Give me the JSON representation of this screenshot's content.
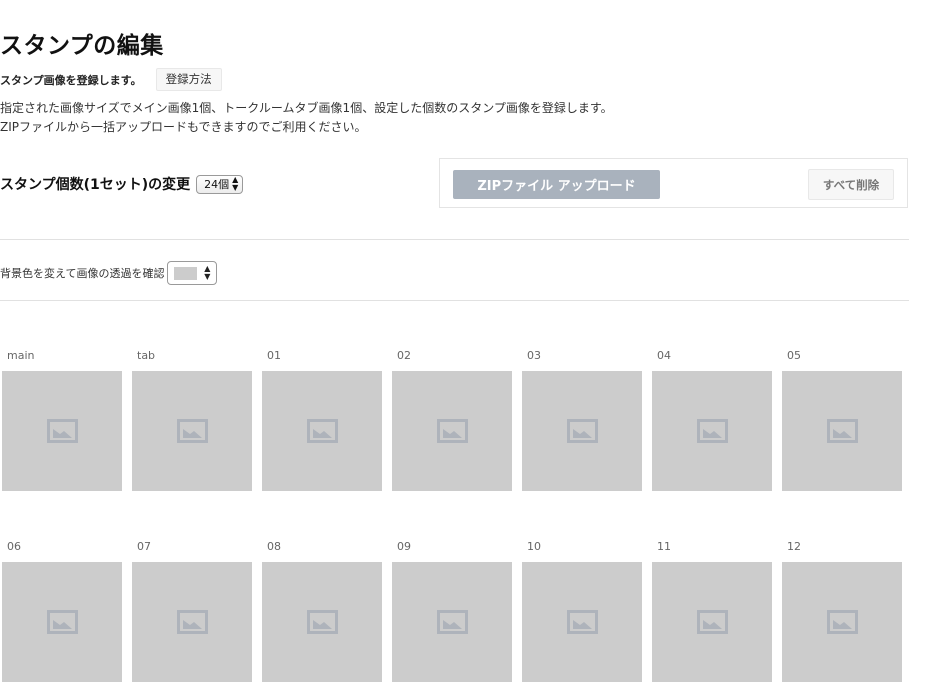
{
  "page": {
    "title": "スタンプの編集",
    "subtitle": "スタンプ画像を登録します。",
    "howto_button": "登録方法",
    "description_lines": [
      "指定された画像サイズでメイン画像1個、トークルームタブ画像1個、設定した個数のスタンプ画像を登録します。",
      "ZIPファイルから一括アップロードもできますのでご利用ください。"
    ]
  },
  "set_count": {
    "label": "スタンプ個数(1セット)の変更",
    "selected": "24個"
  },
  "upload": {
    "zip_button": "ZIPファイル アップロード",
    "delete_all_button": "すべて削除"
  },
  "background": {
    "label": "背景色を変えて画像の透過を確認",
    "selected_color": "#cccccc"
  },
  "slots_row1": [
    "main",
    "tab",
    "01",
    "02",
    "03",
    "04",
    "05"
  ],
  "slots_row2": [
    "06",
    "07",
    "08",
    "09",
    "10",
    "11",
    "12"
  ],
  "icon_names": {
    "placeholder": "image-placeholder-icon",
    "select_arrows": "up-down-arrows-icon"
  },
  "colors": {
    "zip_button_bg": "#a9b2bd",
    "slot_bg": "#cccccc",
    "placeholder_icon": "#aeb3bb"
  }
}
